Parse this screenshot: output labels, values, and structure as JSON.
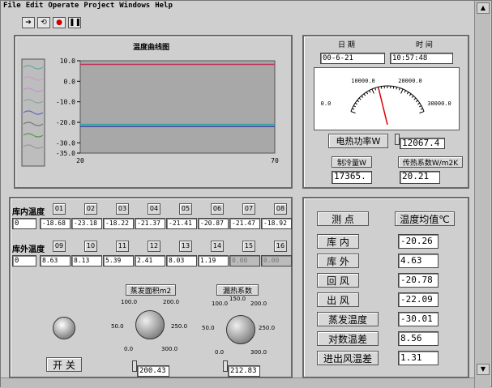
{
  "menu": [
    "File",
    "Edit",
    "Operate",
    "Project",
    "Windows",
    "Help"
  ],
  "chart_panel": {
    "title": "温度曲线图",
    "chart_data": {
      "type": "line",
      "x_range": [
        20,
        70
      ],
      "x_ticks": [
        "20",
        "70"
      ],
      "y_range": [
        -35.0,
        10.0
      ],
      "y_ticks": [
        "10.0",
        "0.0",
        "-10.0",
        "-20.0",
        "-30.0",
        "-35.0"
      ],
      "series_colors": [
        "#c0305a",
        "#2aa8a0",
        "#4040a0"
      ],
      "series_y": [
        8.2,
        -21.0,
        -22.0
      ]
    }
  },
  "meter_panel": {
    "date_label": "日 期",
    "time_label": "时 间",
    "date_value": "00-6-21",
    "time_value": "10:57:48",
    "meter_ticks": [
      "0.0",
      "10000.0",
      "20000.0",
      "30000.0"
    ],
    "meter_value": 12067.4,
    "power_label": "电热功率W",
    "power_value": "12067.4",
    "cooling_label": "制冷量W",
    "cooling_value": "17365.",
    "heat_coef_label": "传热系数W/m2K",
    "heat_coef_value": "20.21"
  },
  "inner_temp": {
    "label": "库内温度",
    "index_label": "0",
    "channels": [
      "01",
      "02",
      "03",
      "04",
      "05",
      "06",
      "07",
      "08"
    ],
    "values": [
      "-18.68",
      "-23.18",
      "-18.22",
      "-21.37",
      "-21.41",
      "-20.87",
      "-21.47",
      "-18.92"
    ]
  },
  "outer_temp": {
    "label": "库外温度",
    "index_label": "0",
    "channels": [
      "09",
      "10",
      "11",
      "12",
      "13",
      "14",
      "15",
      "16"
    ],
    "values": [
      "8.63",
      "8.13",
      "5.39",
      "2.41",
      "8.03",
      "1.19",
      "0.00",
      "0.00"
    ]
  },
  "controls": {
    "switch_label": "开 关",
    "evap_area_label": "蒸发面积m2",
    "evap_ticks": [
      "100.0",
      "200.0",
      "50.0",
      "250.0",
      "0.0",
      "300.0"
    ],
    "evap_value": "200.43",
    "loss_coef_label": "漏热系数",
    "loss_ticks": [
      "100.0",
      "150.0",
      "200.0",
      "50.0",
      "250.0",
      "0.0",
      "300.0"
    ],
    "loss_value": "212.83"
  },
  "measure_panel": {
    "header_point": "测 点",
    "header_avg": "温度均值℃",
    "rows": [
      {
        "name": "库 内",
        "value": "-20.26"
      },
      {
        "name": "库 外",
        "value": "4.63"
      },
      {
        "name": "回 风",
        "value": "-20.78"
      },
      {
        "name": "出 风",
        "value": "-22.09"
      },
      {
        "name": "蒸发温度",
        "value": "-30.01"
      },
      {
        "name": "对数温差",
        "value": "8.56"
      },
      {
        "name": "进出风温差",
        "value": "1.31"
      }
    ]
  }
}
